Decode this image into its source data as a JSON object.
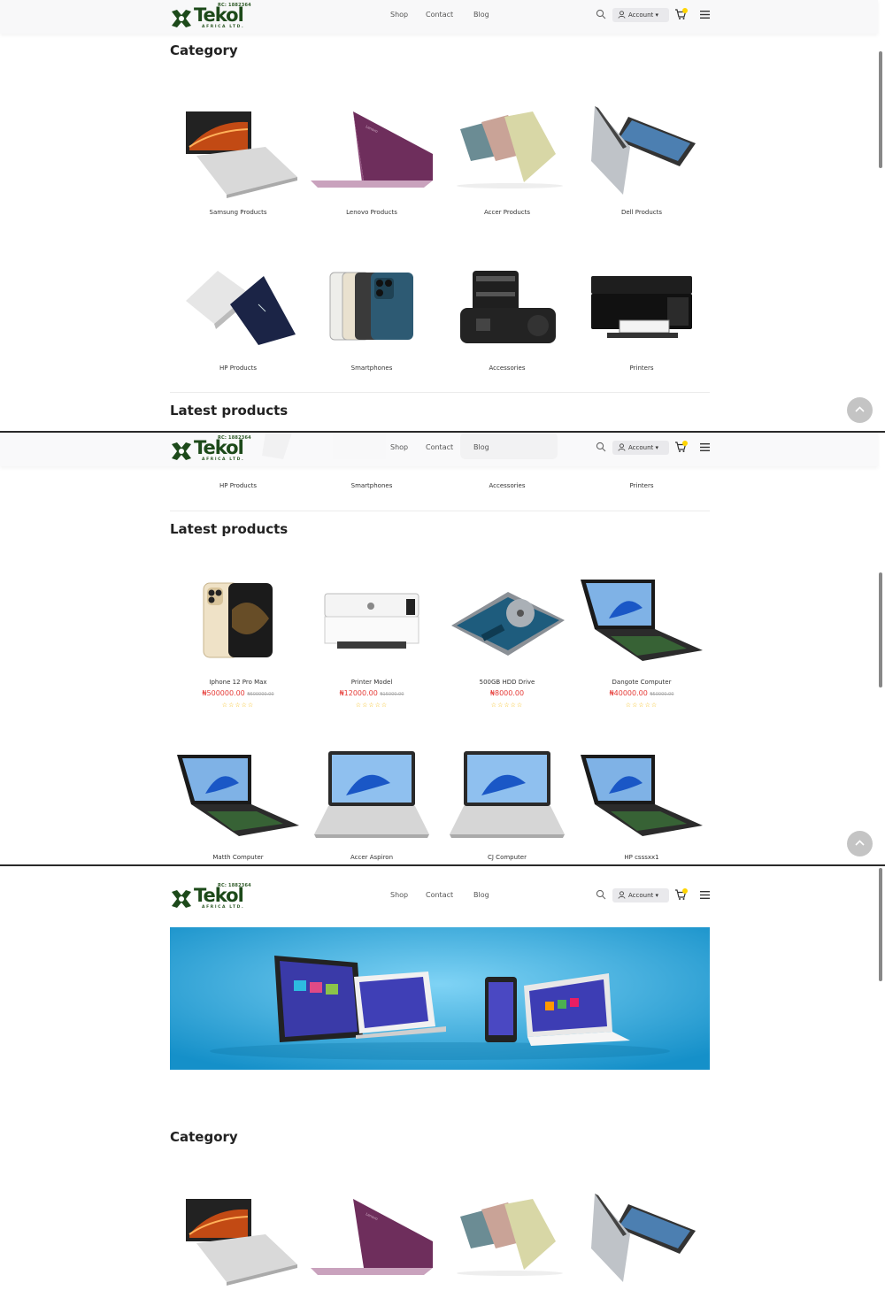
{
  "brand": {
    "name": "Tekol",
    "rc": "RC: 1882364",
    "tagline": "AFRICA LTD."
  },
  "nav": {
    "shop": "Shop",
    "contact": "Contact",
    "blog": "Blog"
  },
  "account": {
    "label": "Account ▾"
  },
  "colors": {
    "brand_green": "#1d4a1a",
    "price_red": "#e53935",
    "star_yellow": "#f5b800",
    "cart_badge": "#ffd500",
    "banner_blue": "#1fa3dd"
  },
  "icons": {
    "search": "search-icon",
    "account": "user-icon",
    "cart": "cart-icon",
    "menu": "hamburger-icon",
    "back_to_top": "chevron-up-icon"
  },
  "sections": {
    "category": "Category",
    "latest": "Latest products"
  },
  "categories": [
    {
      "label": "Samsung Products",
      "image": "laptop-gray"
    },
    {
      "label": "Lenovo Products",
      "image": "laptop-purple"
    },
    {
      "label": "Accer Products",
      "image": "laptops-pastel"
    },
    {
      "label": "Dell Products",
      "image": "laptop-convertible"
    },
    {
      "label": "HP Products",
      "image": "laptops-hp"
    },
    {
      "label": "Smartphones",
      "image": "iphones"
    },
    {
      "label": "Accessories",
      "image": "camera"
    },
    {
      "label": "Printers",
      "image": "printer"
    }
  ],
  "products": [
    {
      "name": "Iphone 12 Pro Max",
      "price": "₦500000.00",
      "old_price": "₦600000.00",
      "rating": "☆☆☆☆☆",
      "image": "iphone"
    },
    {
      "name": "Printer Model",
      "price": "₦12000.00",
      "old_price": "₦15000.00",
      "rating": "☆☆☆☆☆",
      "image": "printer-white"
    },
    {
      "name": "500GB HDD Drive",
      "price": "₦8000.00",
      "old_price": "",
      "rating": "☆☆☆☆☆",
      "image": "hdd"
    },
    {
      "name": "Dangote Computer",
      "price": "₦40000.00",
      "old_price": "₦50000.00",
      "rating": "☆☆☆☆☆",
      "image": "laptop-gaming"
    },
    {
      "name": "Matth Computer",
      "image": "laptop-gaming"
    },
    {
      "name": "Accer Aspiron",
      "image": "laptop-silver"
    },
    {
      "name": "CJ Computer",
      "image": "laptop-silver"
    },
    {
      "name": "HP csssxx1",
      "image": "laptop-gaming"
    }
  ]
}
